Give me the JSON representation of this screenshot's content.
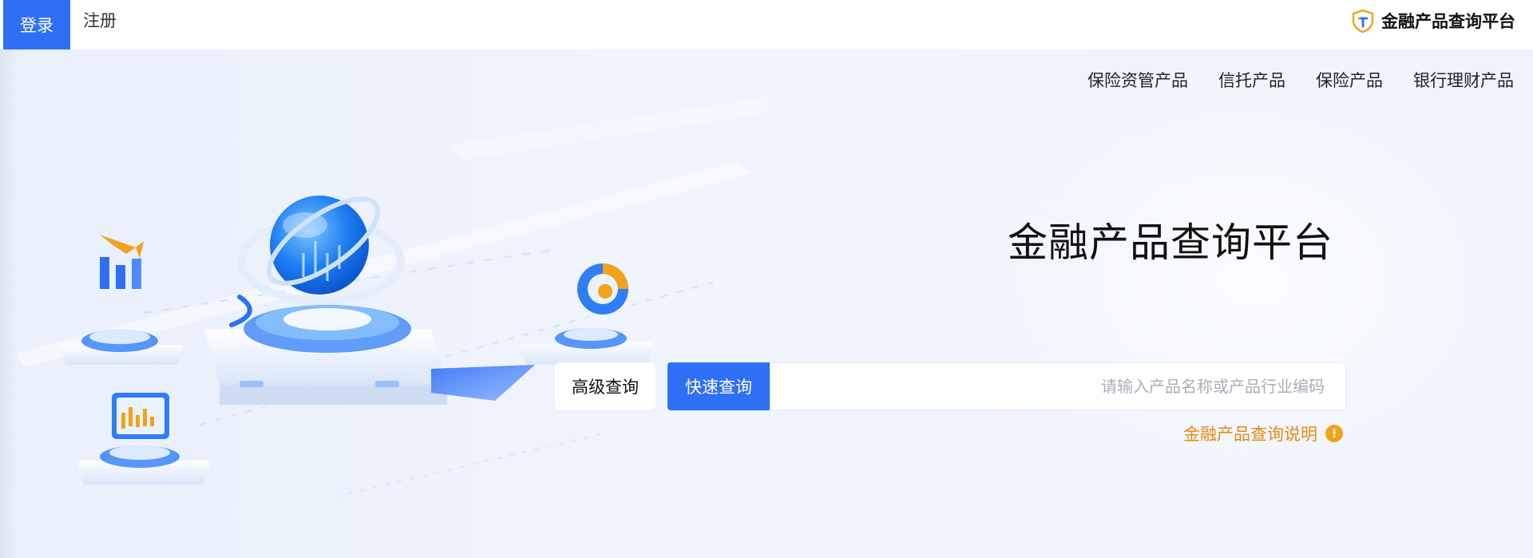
{
  "header": {
    "login_label": "登录",
    "register_label": "注册",
    "brand_name": "金融产品查询平台",
    "logo_icon": "shield-logo-icon"
  },
  "categories": [
    {
      "label": "银行理财产品"
    },
    {
      "label": "保险产品"
    },
    {
      "label": "信托产品"
    },
    {
      "label": "保险资管产品"
    }
  ],
  "hero": {
    "title": "金融产品查询平台"
  },
  "search": {
    "placeholder": "请输入产品名称或产品行业编码",
    "value": "",
    "quick_label": "快速查询",
    "advanced_label": "高级查询"
  },
  "notice": {
    "icon": "info-icon",
    "label": "金融产品查询说明"
  },
  "colors": {
    "primary": "#2f6ff5",
    "notice": "#e48b12",
    "background": "#eef3fb"
  }
}
